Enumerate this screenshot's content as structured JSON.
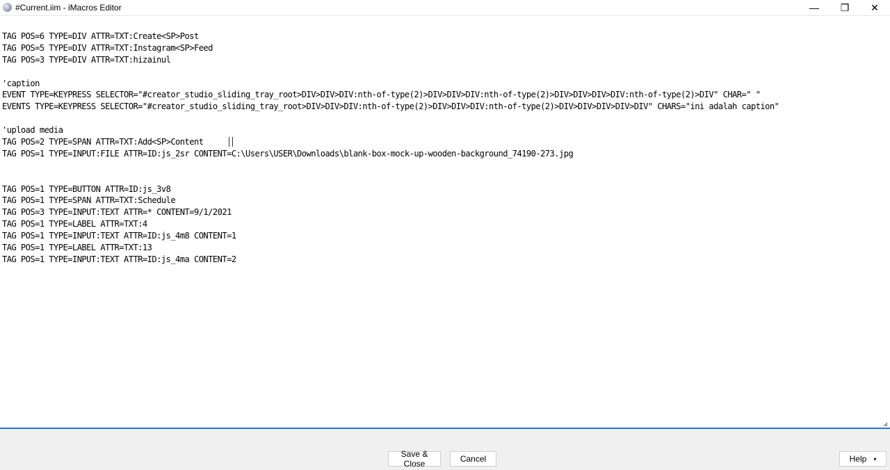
{
  "window": {
    "title": "#Current.iim - iMacros Editor",
    "controls": {
      "minimize": "—",
      "maximize": "❐",
      "close": "✕"
    }
  },
  "editor": {
    "lines": [
      "TAG POS=6 TYPE=DIV ATTR=TXT:Create<SP>Post",
      "TAG POS=5 TYPE=DIV ATTR=TXT:Instagram<SP>Feed",
      "TAG POS=3 TYPE=DIV ATTR=TXT:hizainul",
      "",
      "'caption",
      "EVENT TYPE=KEYPRESS SELECTOR=\"#creator_studio_sliding_tray_root>DIV>DIV>DIV:nth-of-type(2)>DIV>DIV>DIV:nth-of-type(2)>DIV>DIV>DIV>DIV:nth-of-type(2)>DIV\" CHAR=\" \"",
      "EVENTS TYPE=KEYPRESS SELECTOR=\"#creator_studio_sliding_tray_root>DIV>DIV>DIV:nth-of-type(2)>DIV>DIV>DIV:nth-of-type(2)>DIV>DIV>DIV>DIV>DIV\" CHARS=\"ini adalah caption\"",
      "",
      "'upload media",
      "TAG POS=2 TYPE=SPAN ATTR=TXT:Add<SP>Content",
      "TAG POS=1 TYPE=INPUT:FILE ATTR=ID:js_2sr CONTENT=C:\\Users\\USER\\Downloads\\blank-box-mock-up-wooden-background_74190-273.jpg",
      "",
      "",
      "TAG POS=1 TYPE=BUTTON ATTR=ID:js_3v8",
      "TAG POS=1 TYPE=SPAN ATTR=TXT:Schedule",
      "TAG POS=3 TYPE=INPUT:TEXT ATTR=* CONTENT=9/1/2021",
      "TAG POS=1 TYPE=LABEL ATTR=TXT:4",
      "TAG POS=1 TYPE=INPUT:TEXT ATTR=ID:js_4m8 CONTENT=1",
      "TAG POS=1 TYPE=LABEL ATTR=TXT:13",
      "TAG POS=1 TYPE=INPUT:TEXT ATTR=ID:js_4ma CONTENT=2"
    ]
  },
  "footer": {
    "save_close": "Save & Close",
    "cancel": "Cancel",
    "help": "Help"
  },
  "colors": {
    "accent_separator": "#1e7bd6",
    "footer_bg": "#f0f0f0"
  }
}
